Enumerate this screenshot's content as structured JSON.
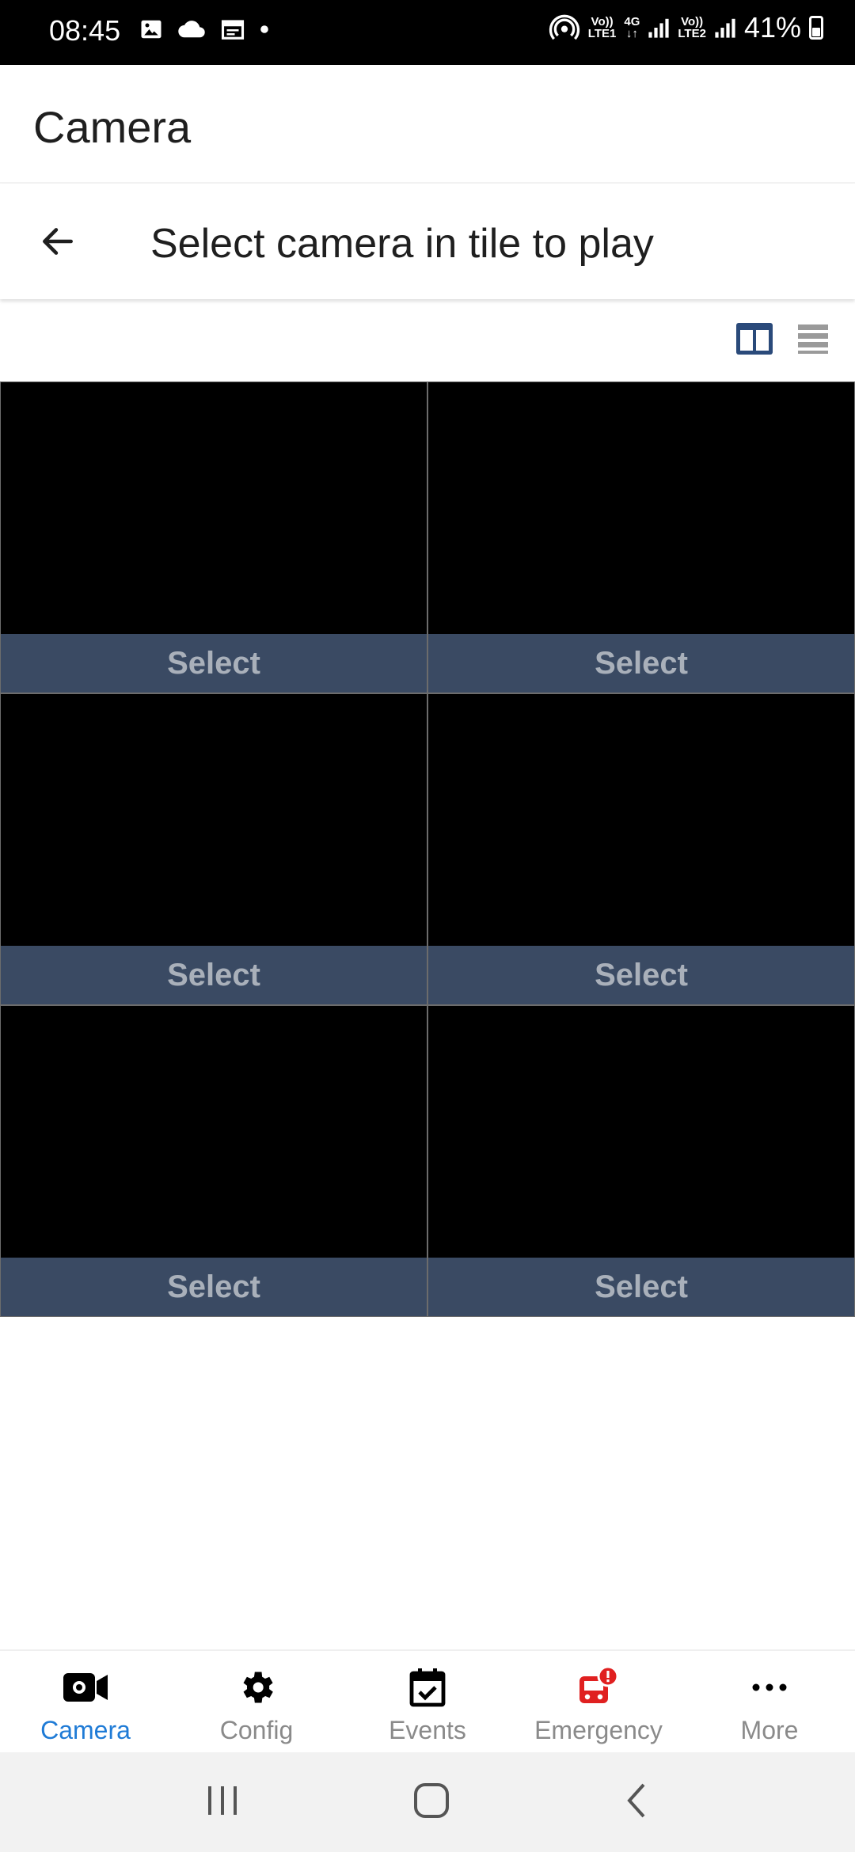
{
  "status_bar": {
    "time": "08:45",
    "sim1_label_top": "Vo))",
    "sim1_label_bottom": "LTE1",
    "network_label": "4G",
    "sim2_label_top": "Vo))",
    "sim2_label_bottom": "LTE2",
    "battery": "41%"
  },
  "app": {
    "title": "Camera"
  },
  "header": {
    "title": "Select camera in tile to play"
  },
  "tiles": [
    {
      "label": "Select"
    },
    {
      "label": "Select"
    },
    {
      "label": "Select"
    },
    {
      "label": "Select"
    },
    {
      "label": "Select"
    },
    {
      "label": "Select"
    }
  ],
  "bottom_nav": {
    "items": [
      {
        "label": "Camera",
        "icon": "camera-icon",
        "active": true
      },
      {
        "label": "Config",
        "icon": "gear-icon"
      },
      {
        "label": "Events",
        "icon": "calendar-check-icon"
      },
      {
        "label": "Emergency",
        "icon": "emergency-train-icon"
      },
      {
        "label": "More",
        "icon": "more-dots-icon"
      }
    ]
  },
  "colors": {
    "accent": "#1f7bd6",
    "tile_footer": "#3a4a63",
    "emergency": "#e02020"
  }
}
